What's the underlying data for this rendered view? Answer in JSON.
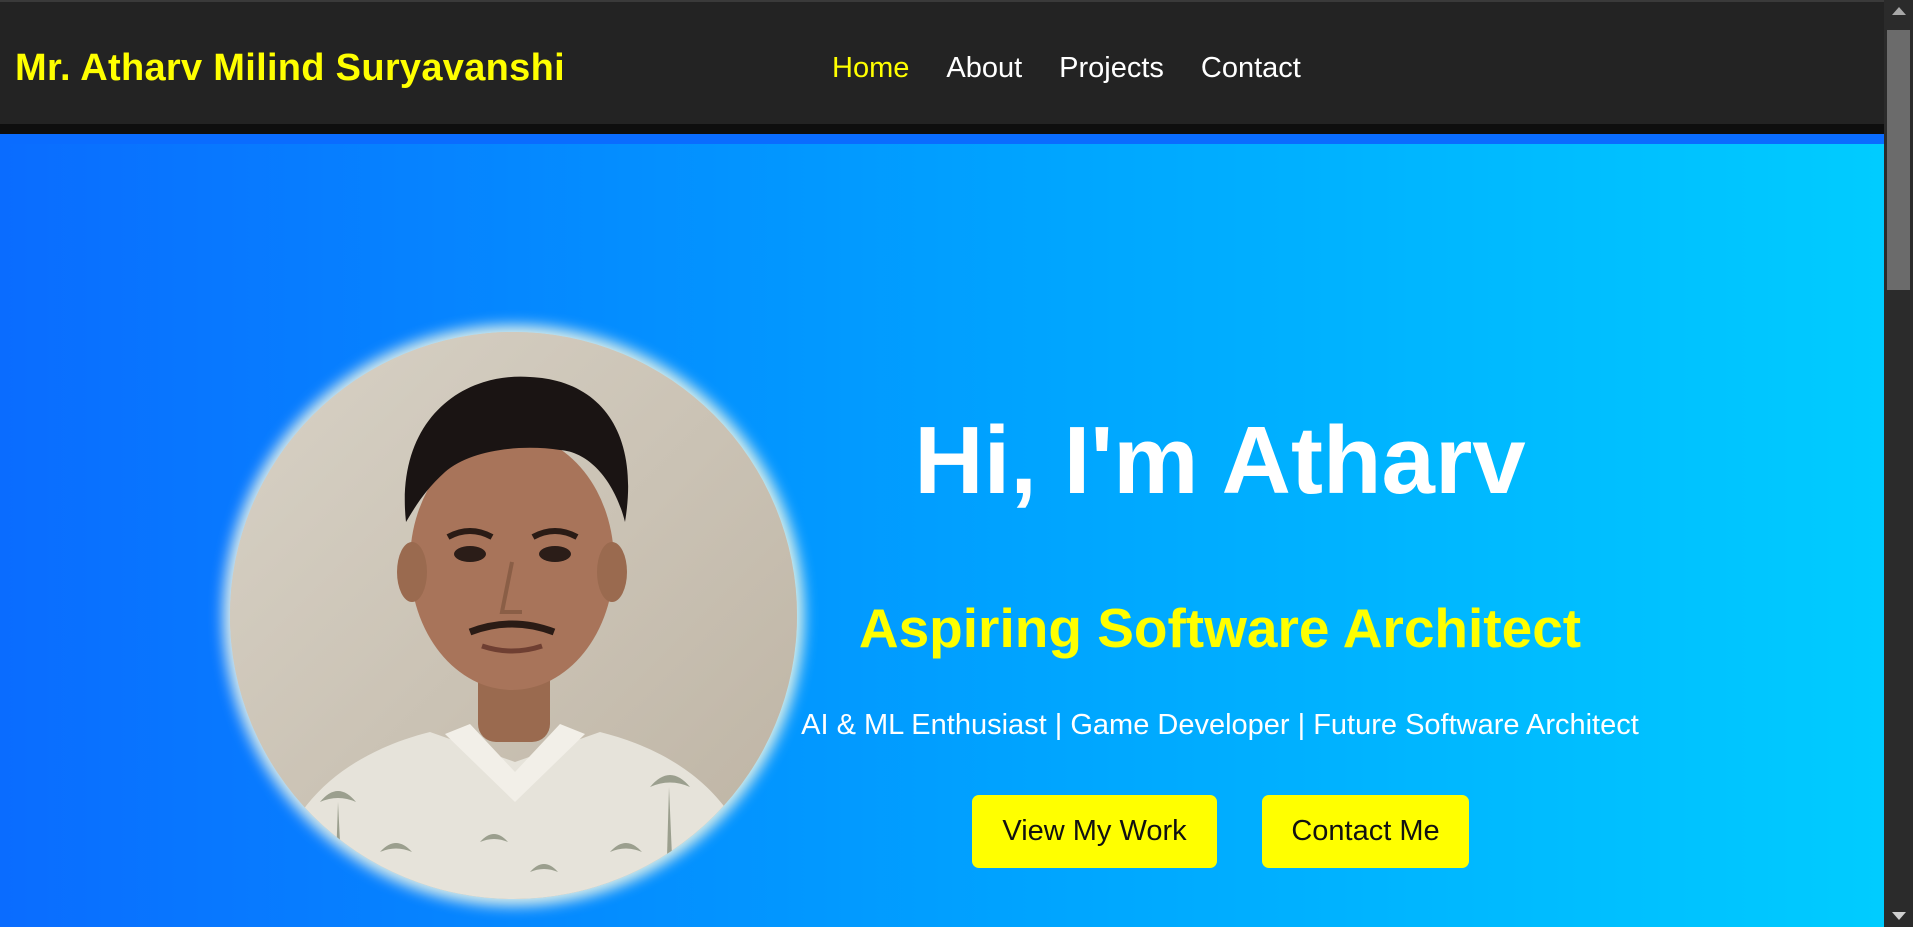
{
  "navbar": {
    "brand": "Mr. Atharv Milind Suryavanshi",
    "links": [
      "Home",
      "About",
      "Projects",
      "Contact"
    ],
    "active": "Home"
  },
  "hero": {
    "title": "Hi, I'm Atharv",
    "subtitle": "Aspiring Software Architect",
    "tagline": "AI & ML Enthusiast | Game Developer | Future Software Architect",
    "primary_button": "View My Work",
    "secondary_button": "Contact Me"
  },
  "colors": {
    "navbar_bg": "#232323",
    "accent": "#ffff00",
    "gradient_start": "#0a6cff",
    "gradient_end": "#00ccff",
    "text": "#ffffff"
  },
  "icons": [
    "scroll-up-arrow-icon",
    "scroll-down-arrow-icon"
  ]
}
